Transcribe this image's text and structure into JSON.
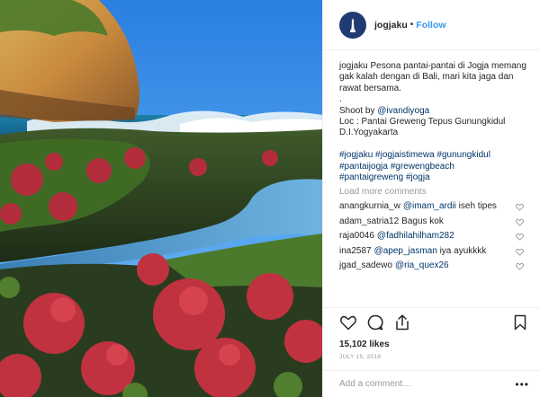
{
  "header": {
    "username": "jogjaku",
    "separator": "•",
    "follow_label": "Follow"
  },
  "caption": {
    "user": "jogjaku",
    "text_1": "Pesona pantai-pantai di Jogja memang gak kalah dengan di Bali, mari kita jaga dan rawat bersama.",
    "dot": ".",
    "shoot_label": "Shoot by",
    "shoot_mention": "@ivandiyoga",
    "loc_line_1": "Loc : Pantai Greweng Tepus Gunungkidul",
    "loc_line_2": "D.I.Yogyakarta",
    "hashtags": [
      "#jogjaku",
      "#jogjaistimewa",
      "#gunungkidul",
      "#pantaijogja",
      "#grewengbeach",
      "#pantaigreweng",
      "#jogja"
    ]
  },
  "load_more_label": "Load more comments",
  "comments": [
    {
      "user": "anangkurnia_w",
      "mention": "@imam_ardii",
      "text": "iseh tipes"
    },
    {
      "user": "adam_satria12",
      "mention": "",
      "text": "Bagus kok"
    },
    {
      "user": "raja0046",
      "mention": "@fadhilahilham282",
      "text": ""
    },
    {
      "user": "ina2587",
      "mention": "@apep_jasman",
      "text": "iya ayukkkk"
    },
    {
      "user": "jgad_sadewo",
      "mention": "@ria_quex26",
      "text": ""
    }
  ],
  "likes_label": "15,102 likes",
  "date_label": "JULY 15, 2018",
  "add_comment_placeholder": "Add a comment…",
  "more_label": "•••",
  "icons": {
    "like": "heart-icon",
    "comment": "comment-bubble-icon",
    "share": "share-icon",
    "save": "bookmark-icon",
    "comment_like": "small-heart-icon",
    "avatar": "monument-avatar-icon"
  },
  "colors": {
    "link": "#003569",
    "follow": "#3897f0",
    "muted": "#999999",
    "text": "#262626"
  }
}
